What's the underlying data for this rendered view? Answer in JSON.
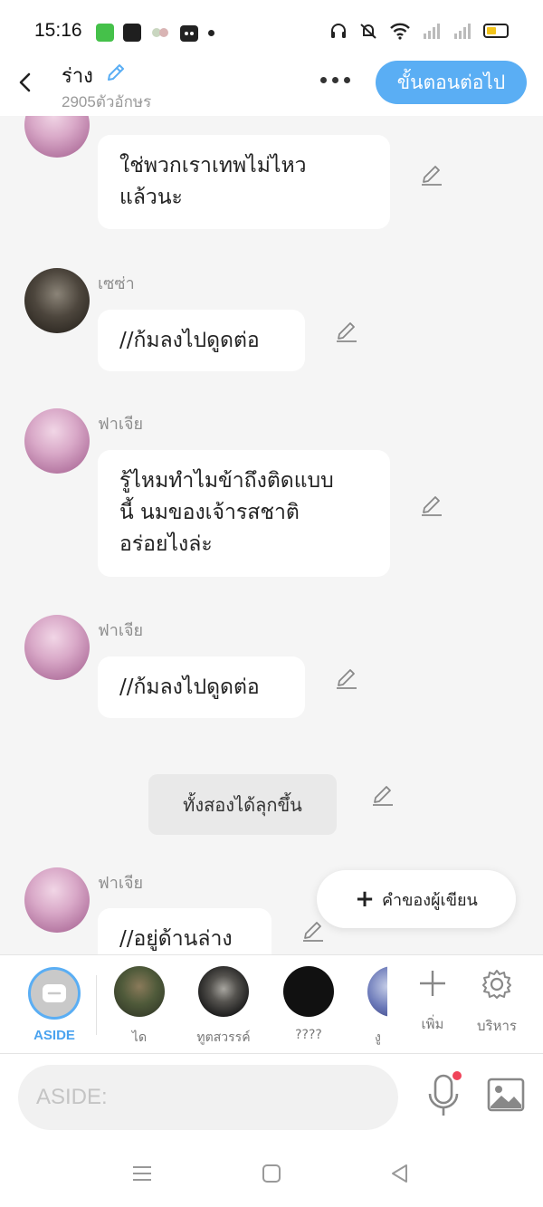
{
  "status_bar": {
    "time": "15:16",
    "icons": [
      "wechat-icon",
      "facebook-icon",
      "game-icon",
      "cat-app-icon",
      "dot-icon",
      "headset-icon",
      "mute-icon",
      "wifi-icon",
      "signal-icon",
      "signal-icon",
      "battery-icon"
    ]
  },
  "header": {
    "title": "ร่าง",
    "char_count": "2905ตัวอักษร",
    "next_button": "ขั้นตอนต่อไป"
  },
  "messages": [
    {
      "type": "bubble",
      "speaker": "",
      "text_lines": [
        "ใช่พวกเราเทพไม่ไหว",
        "แล้วนะ"
      ]
    },
    {
      "type": "bubble",
      "speaker": "เซซ่า",
      "text_lines": [
        "//ก้มลงไปดูดต่อ"
      ]
    },
    {
      "type": "bubble",
      "speaker": "ฟาเจีย",
      "text_lines": [
        "รู้ไหมทำไมข้าถึงติดแบบ",
        "นี้ นมของเจ้ารสชาติ",
        "อร่อยไงล่ะ"
      ]
    },
    {
      "type": "bubble",
      "speaker": "ฟาเจีย",
      "text_lines": [
        "//ก้มลงไปดูดต่อ"
      ]
    },
    {
      "type": "narration",
      "text": "ทั้งสองได้ลุกขึ้น"
    },
    {
      "type": "bubble",
      "speaker": "ฟาเจีย",
      "text_lines": [
        "//อยู่ด้านล่าง"
      ]
    }
  ],
  "author_button": "คำของผู้เขียน",
  "characters": [
    {
      "label": "ASIDE"
    },
    {
      "label": "ได"
    },
    {
      "label": "ทูตสวรรค์"
    },
    {
      "label": "????"
    },
    {
      "label": "งู"
    }
  ],
  "tools": {
    "add": "เพิ่ม",
    "manage": "บริหาร"
  },
  "input": {
    "placeholder": "ASIDE:"
  },
  "colors": {
    "accent": "#5aaef4",
    "background": "#f5f5f5",
    "bubble": "#ffffff",
    "notification_dot": "#f0445a"
  }
}
